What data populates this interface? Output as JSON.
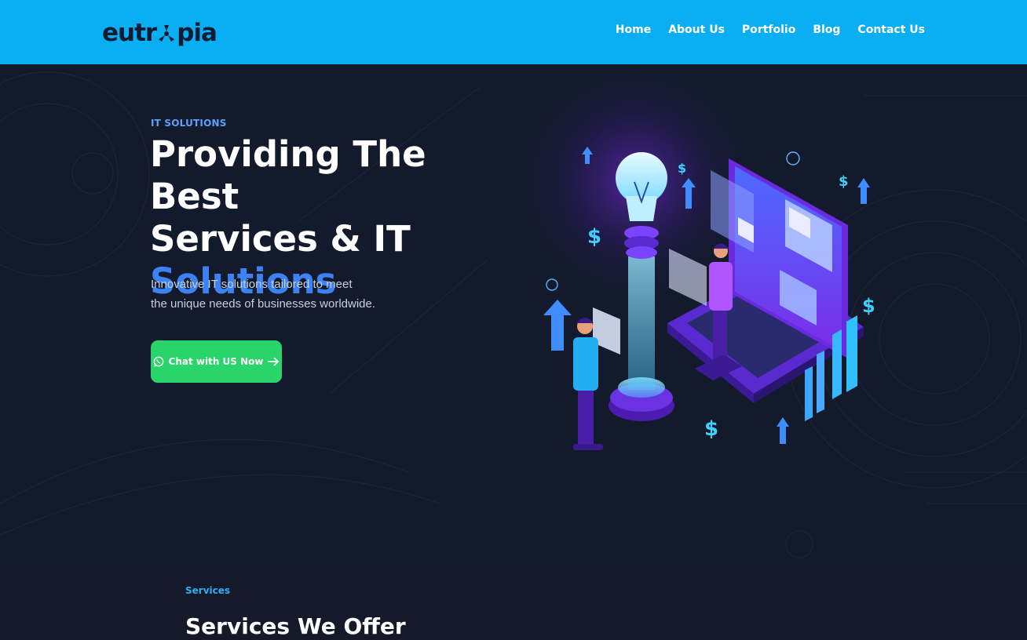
{
  "brand": {
    "logo_before": "eutr",
    "logo_after": "pia",
    "colors": {
      "header": "#0aaef2",
      "accent": "#3d82f5",
      "cta": "#29d46a",
      "hero_bg": "#131a2b"
    }
  },
  "nav": {
    "items": [
      {
        "label": "Home"
      },
      {
        "label": "About Us"
      },
      {
        "label": "Portfolio"
      },
      {
        "label": "Blog"
      },
      {
        "label": "Contact Us"
      }
    ]
  },
  "hero": {
    "eyebrow": "IT SOLUTIONS",
    "title_line1": "Providing The Best",
    "title_line2": "Services & IT",
    "title_accent": "Solutions",
    "subtext_line1": "Innovative IT solutions tailored to meet",
    "subtext_line2": "the unique needs of businesses worldwide.",
    "cta_label": "Chat with US Now",
    "cta_icon": "whatsapp-icon",
    "cta_arrow_icon": "arrow-right-icon"
  },
  "services": {
    "eyebrow": "Services",
    "title": "Services We Offer"
  }
}
